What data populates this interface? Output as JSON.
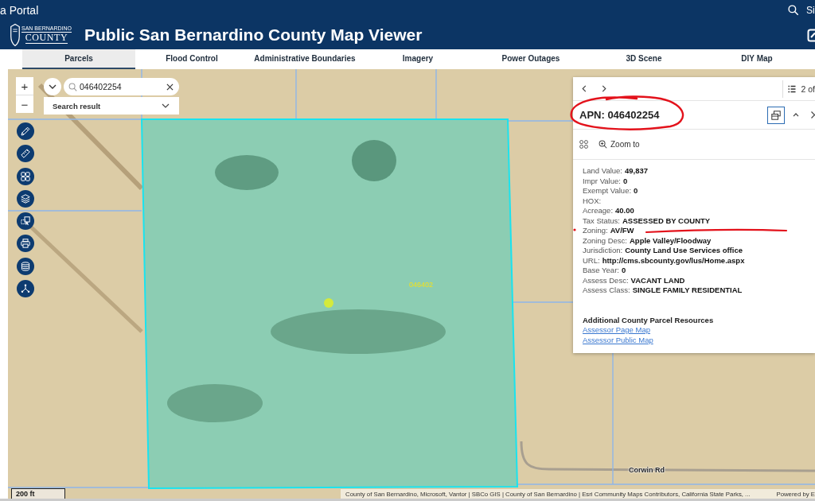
{
  "portal_bar": {
    "title": "a Portal",
    "account": "Si"
  },
  "header": {
    "logo": {
      "top": "SAN BERNARDINO",
      "bottom": "COUNTY"
    },
    "title": "Public San Bernardino County Map Viewer"
  },
  "tabs": [
    {
      "label": "Parcels",
      "selected": true
    },
    {
      "label": "Flood Control",
      "selected": false
    },
    {
      "label": "Administrative Boundaries",
      "selected": false
    },
    {
      "label": "Imagery",
      "selected": false
    },
    {
      "label": "Power Outages",
      "selected": false
    },
    {
      "label": "3D Scene",
      "selected": false
    },
    {
      "label": "DIY Map",
      "selected": false
    }
  ],
  "map": {
    "zoom_in": "+",
    "zoom_out": "−",
    "search": {
      "value": "046402254"
    },
    "search_source": {
      "value": "Search result"
    },
    "parcel_label": "046402",
    "road_label": "Corwin Rd",
    "scale": "200 ft",
    "attribution": "County of San Bernardino, Microsoft, Vantor | SBCo GIS | County of San Bernardino | Esri Community Maps Contributors, California State Parks, ...",
    "powered_by": "Powered by E"
  },
  "popup": {
    "pager": "2 of",
    "title": "APN: 046402254",
    "zoom_action": "Zoom to",
    "fields": [
      {
        "label": "Land Value:",
        "value": "49,837"
      },
      {
        "label": "Impr Value:",
        "value": "0"
      },
      {
        "label": "Exempt Value:",
        "value": "0"
      },
      {
        "label": "HOX:"
      },
      {
        "label": "Acreage:",
        "value": "40.00"
      },
      {
        "label": "Tax Status:",
        "value": "ASSESSED BY COUNTY"
      },
      {
        "label": "Zoning:",
        "value": "AV/FW"
      },
      {
        "label": "Zoning Desc:",
        "value": "Apple Valley/Floodway"
      },
      {
        "label": "Jurisdiction:",
        "value": "County Land Use Services office"
      },
      {
        "label": "URL:",
        "value": "http://cms.sbcounty.gov/lus/Home.aspx"
      },
      {
        "label": "Base Year:",
        "value": "0"
      },
      {
        "label": "Assess Desc:",
        "value": "VACANT LAND"
      },
      {
        "label": "Assess Class:",
        "value": "SINGLE FAMILY RESIDENTIAL"
      }
    ],
    "resources": {
      "heading": "Additional County Parcel Resources",
      "links": [
        "Assessor Page Map",
        "Assessor Public Map"
      ]
    }
  },
  "pen_marks": [
    {
      "kind": "ellipse"
    },
    {
      "kind": "dot"
    },
    {
      "kind": "underline"
    }
  ]
}
